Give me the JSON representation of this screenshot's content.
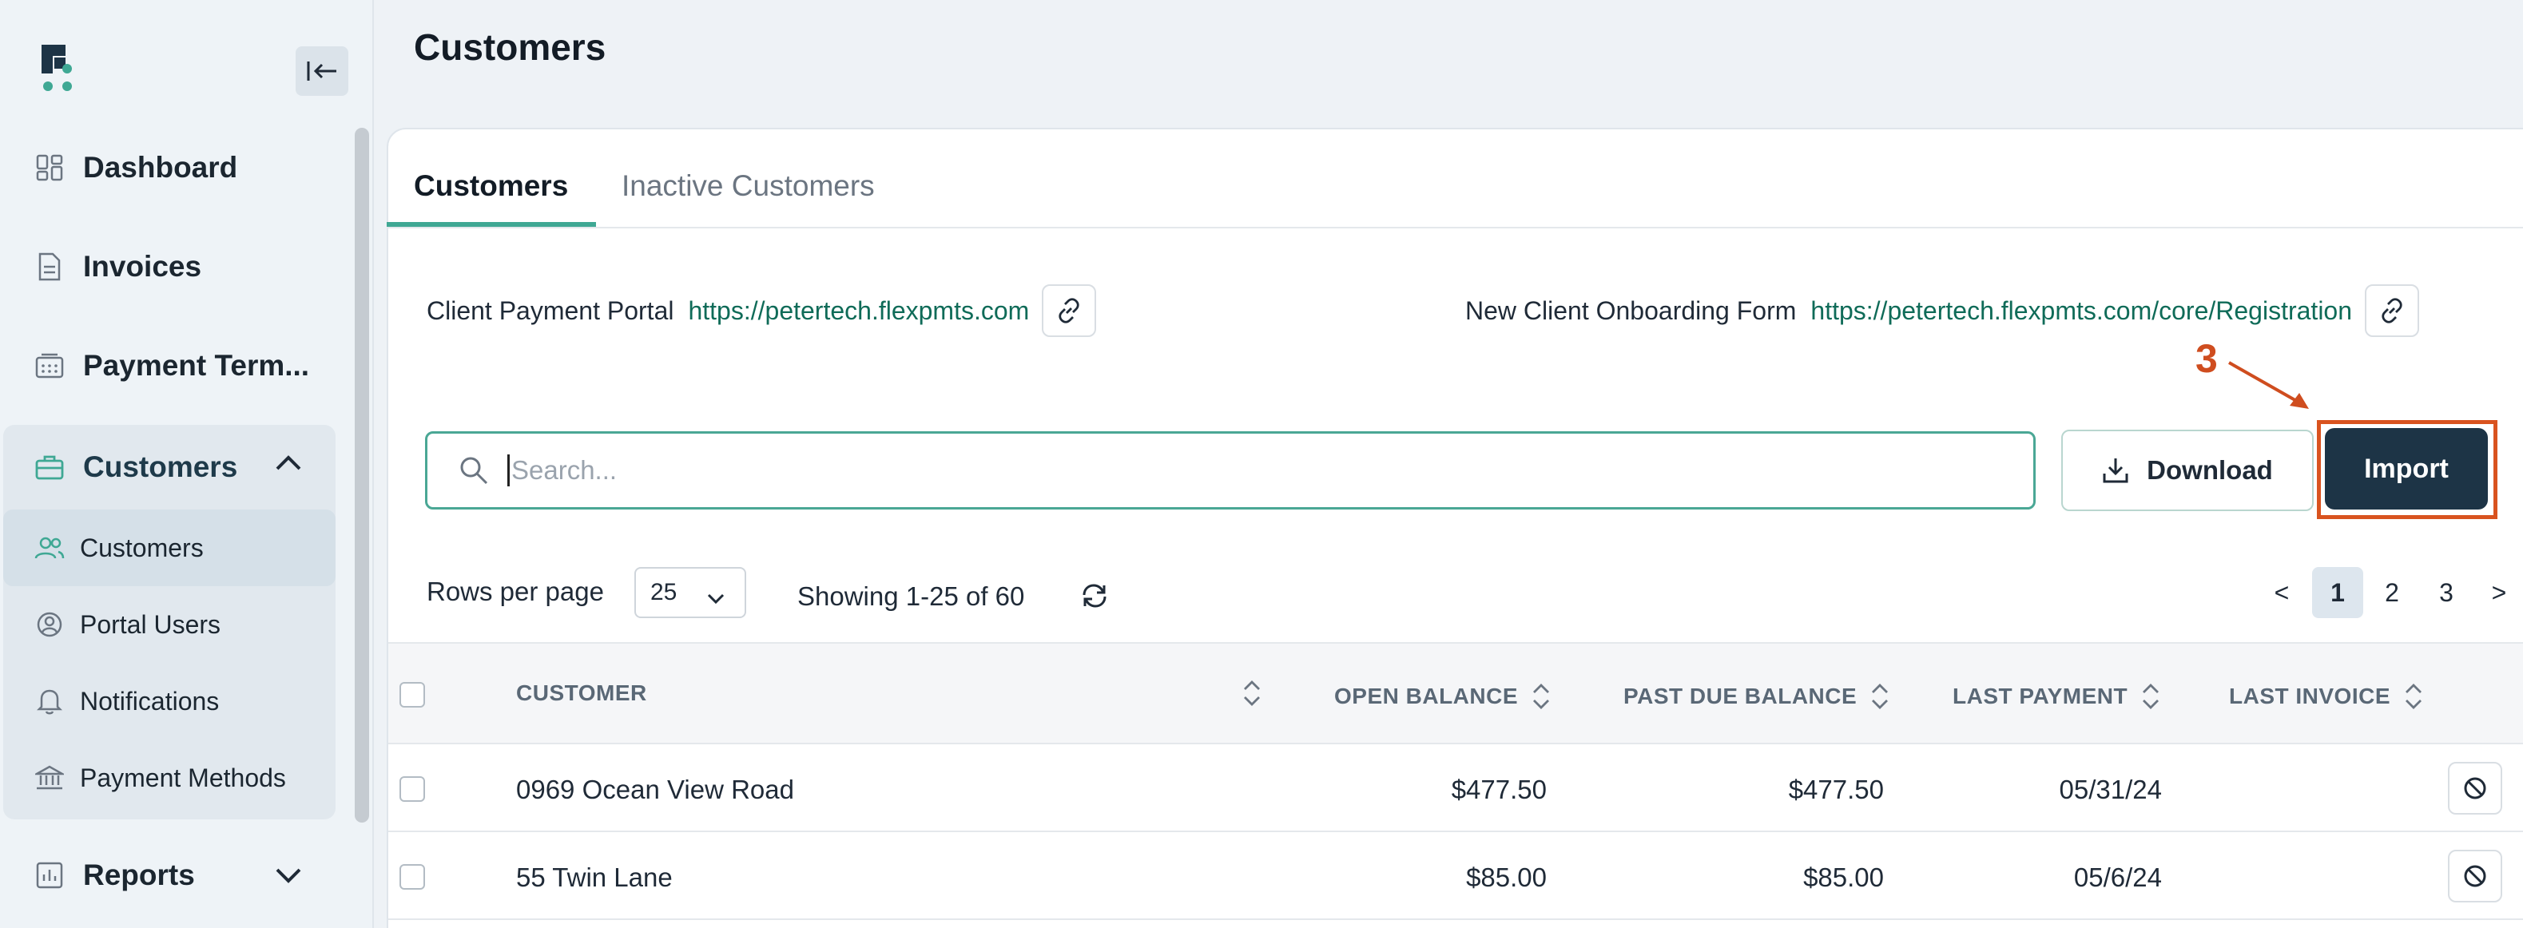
{
  "sidebar": {
    "nav": [
      {
        "label": "Dashboard",
        "icon": "grid-icon"
      },
      {
        "label": "Invoices",
        "icon": "document-icon"
      },
      {
        "label": "Payment Term..."
      }
    ],
    "customers_group": {
      "label": "Customers",
      "items": [
        {
          "label": "Customers",
          "icon": "users-icon",
          "active": true
        },
        {
          "label": "Portal Users",
          "icon": "user-circle-icon"
        },
        {
          "label": "Notifications",
          "icon": "bell-icon"
        },
        {
          "label": "Payment Methods",
          "icon": "bank-icon"
        }
      ]
    },
    "reports_label": "Reports"
  },
  "page": {
    "title": "Customers"
  },
  "tabs": [
    {
      "label": "Customers",
      "active": true
    },
    {
      "label": "Inactive Customers",
      "active": false
    }
  ],
  "portal": {
    "client_label": "Client Payment Portal",
    "client_url": "https://petertech.flexpmts.com",
    "onboarding_label": "New Client Onboarding Form",
    "onboarding_url": "https://petertech.flexpmts.com/core/Registration"
  },
  "annotation": {
    "step": "3"
  },
  "search": {
    "placeholder": "Search..."
  },
  "actions": {
    "download_label": "Download",
    "import_label": "Import"
  },
  "pagination": {
    "rows_label": "Rows per page",
    "rows_value": "25",
    "showing": "Showing 1-25 of 60",
    "prev": "<",
    "next": ">",
    "pages": [
      "1",
      "2",
      "3"
    ],
    "current": "1"
  },
  "table": {
    "headers": [
      "CUSTOMER",
      "OPEN BALANCE",
      "PAST DUE BALANCE",
      "LAST PAYMENT",
      "LAST INVOICE"
    ],
    "rows": [
      {
        "customer": "0969 Ocean View Road",
        "open_balance": "$477.50",
        "past_due": "$477.50",
        "last_payment": "05/31/24",
        "last_invoice": ""
      },
      {
        "customer": "55 Twin Lane",
        "open_balance": "$85.00",
        "past_due": "$85.00",
        "last_payment": "05/6/24",
        "last_invoice": ""
      }
    ]
  },
  "colors": {
    "accent": "#3fa894",
    "link": "#0f6b58",
    "primary_button": "#1d3446",
    "annotation": "#d9531f"
  }
}
